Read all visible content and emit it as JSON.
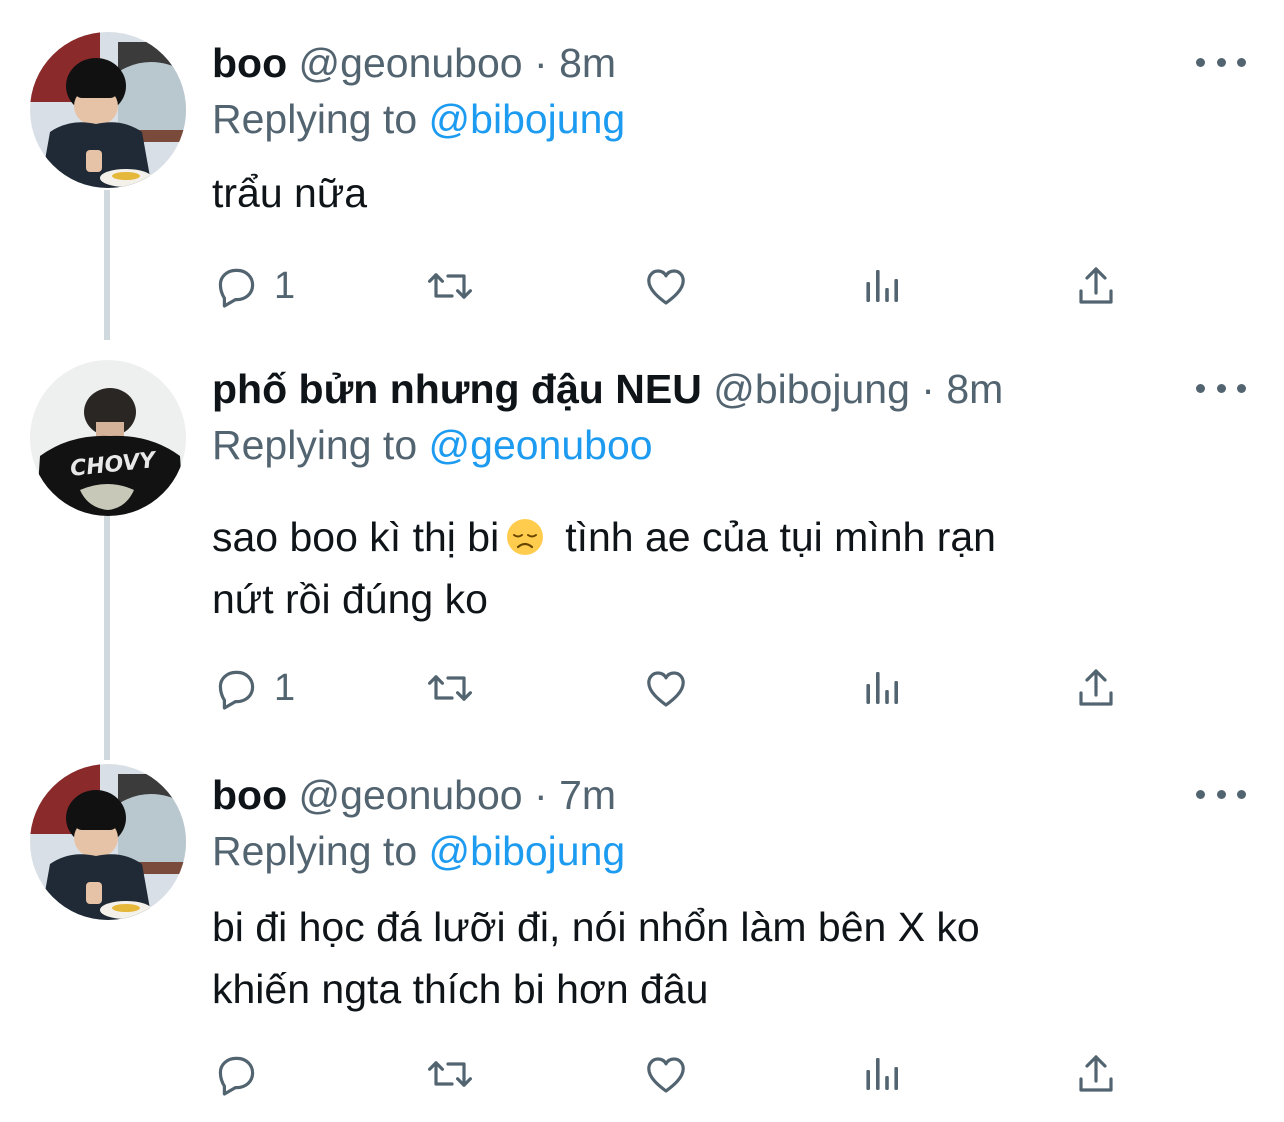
{
  "tweets": [
    {
      "name": "boo",
      "handle": "@geonuboo",
      "separator": "·",
      "time": "8m",
      "replying_prefix": "Replying to",
      "replying_to": "@bibojung",
      "text_line1": "trẩu nữa",
      "text_line2": "",
      "emoji": "",
      "text_after_emoji": "",
      "reply_count": "1"
    },
    {
      "name": "phố bửn nhưng đậu NEU",
      "handle": "@bibojung",
      "separator": "·",
      "time": "8m",
      "replying_prefix": "Replying to",
      "replying_to": "@geonuboo",
      "text_line1": "sao boo kì thị bi",
      "emoji": "disappointed-face",
      "text_after_emoji": "tình ae của tụi mình rạn",
      "text_line2": "nứt rồi đúng ko",
      "reply_count": "1"
    },
    {
      "name": "boo",
      "handle": "@geonuboo",
      "separator": "·",
      "time": "7m",
      "replying_prefix": "Replying to",
      "replying_to": "@bibojung",
      "text_line1": "bi đi học đá lưỡi đi, nói nhổn làm bên X ko",
      "text_line2": "khiến ngta thích bi hơn đâu",
      "emoji": "",
      "text_after_emoji": "",
      "reply_count": ""
    }
  ],
  "colors": {
    "text": "#0f1419",
    "secondary": "#536471",
    "accent": "#1d9bf0",
    "connector": "#cfd9de"
  },
  "icons": [
    "reply-icon",
    "retweet-icon",
    "like-icon",
    "views-icon",
    "share-icon",
    "more-icon",
    "disappointed-face-emoji"
  ]
}
